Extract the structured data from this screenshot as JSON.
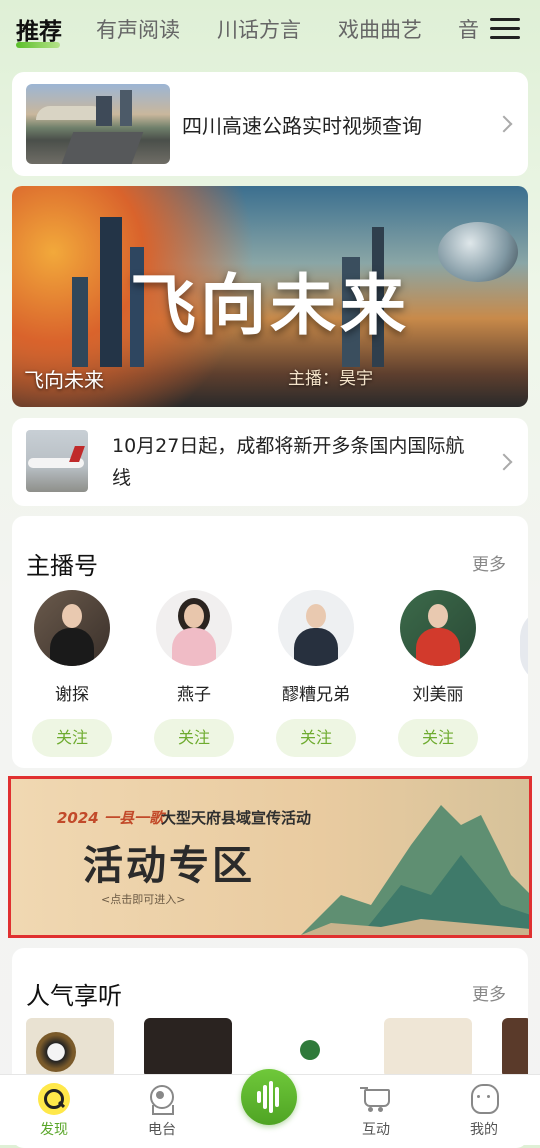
{
  "tabs": [
    "推荐",
    "有声阅读",
    "川话方言",
    "戏曲曲艺",
    "音"
  ],
  "news_top": {
    "title": "四川高速公路实时视频查询"
  },
  "banner": {
    "title": "飞向未来",
    "subtitle": "飞向未来",
    "host": "主播：昊宇"
  },
  "news_second": {
    "title": "10月27日起，成都将新开多条国内国际航线"
  },
  "hosts_section": {
    "title": "主播号",
    "more": "更多",
    "hosts": [
      {
        "name": "谢探",
        "follow": "关注"
      },
      {
        "name": "燕子",
        "follow": "关注"
      },
      {
        "name": "醪糟兄弟",
        "follow": "关注"
      },
      {
        "name": "刘美丽",
        "follow": "关注"
      }
    ]
  },
  "activity": {
    "year": "2024 一县一歌",
    "campaign": "大型天府县域宣传活动",
    "title": "活动专区",
    "hint": "<点击即可进入>"
  },
  "popular": {
    "title": "人气享听",
    "more": "更多"
  },
  "bottom_nav": [
    {
      "label": "发现",
      "icon": "discover-icon",
      "active": true
    },
    {
      "label": "电台",
      "icon": "radio-icon",
      "active": false
    },
    {
      "label": "",
      "icon": "voice-wave-icon",
      "active": false
    },
    {
      "label": "互动",
      "icon": "cart-icon",
      "active": false
    },
    {
      "label": "我的",
      "icon": "profile-icon",
      "active": false
    }
  ],
  "colors": {
    "accent": "#5bbf2a",
    "follow_text": "#6eab2f",
    "highlight_border": "#e03030"
  }
}
